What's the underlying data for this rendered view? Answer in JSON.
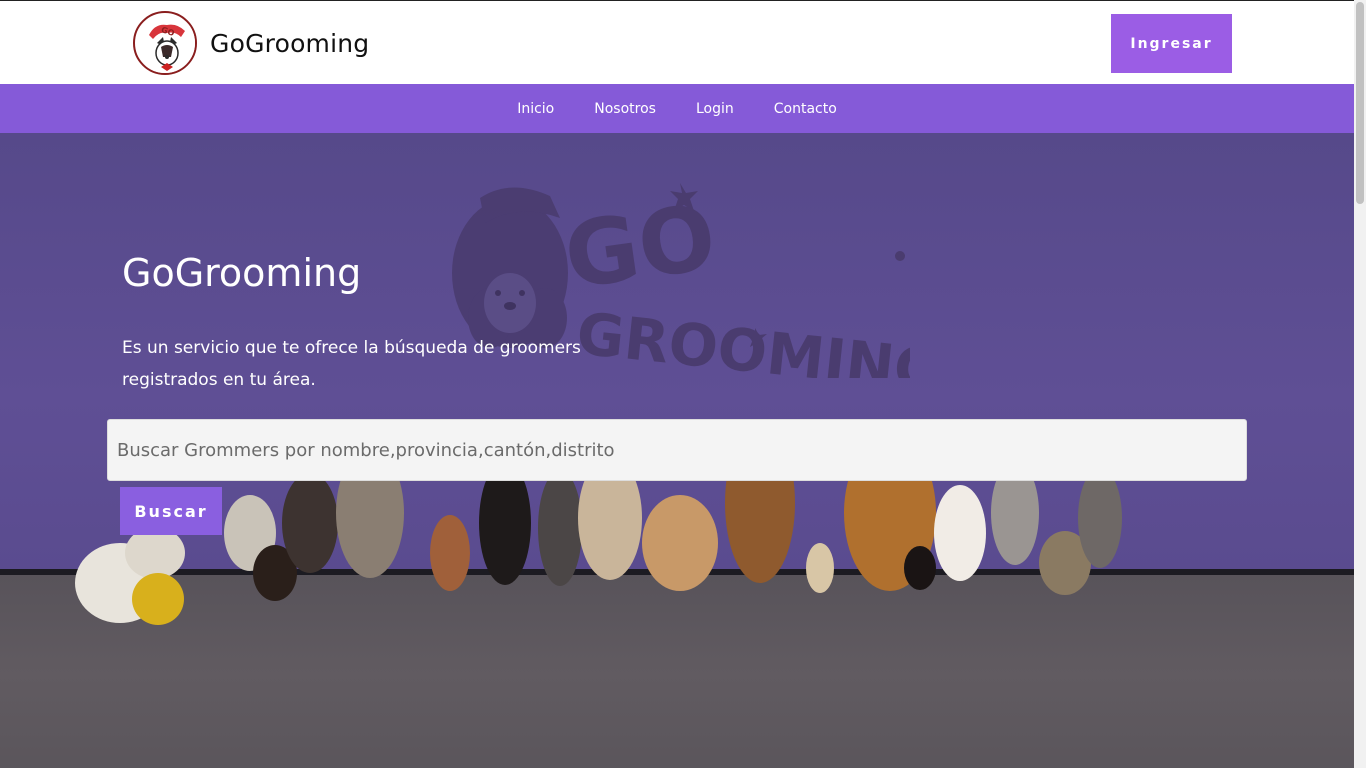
{
  "brand": {
    "name": "GoGrooming",
    "logo_text": "GO GROOMING"
  },
  "header": {
    "login_button": "Ingresar"
  },
  "nav": {
    "items": [
      {
        "label": "Inicio"
      },
      {
        "label": "Nosotros"
      },
      {
        "label": "Login"
      },
      {
        "label": "Contacto"
      }
    ]
  },
  "hero": {
    "title": "GoGrooming",
    "description": "Es un servicio que te ofrece la búsqueda de groomers registrados en tu área.",
    "wall_logo_line1": "GO",
    "wall_logo_line2": "GROOMING"
  },
  "search": {
    "placeholder": "Buscar Grommers por nombre,provincia,cantón,distrito",
    "button_label": "Buscar"
  },
  "colors": {
    "accent": "#9b5de5",
    "nav": "#855ad8",
    "button": "#8a5fe0",
    "wall": "#5f4e93"
  }
}
